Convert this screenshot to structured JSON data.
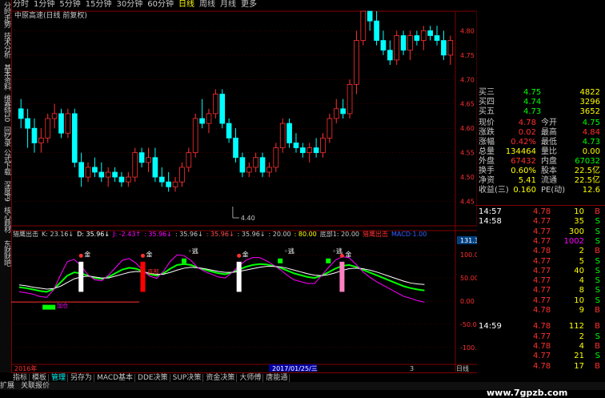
{
  "topbar": {
    "periods": [
      "分时",
      "1分钟",
      "5分钟",
      "15分钟",
      "30分钟",
      "60分钟",
      "日线",
      "周线",
      "月线",
      "更多"
    ],
    "active": "日线"
  },
  "left_tabs": [
    "分时走势",
    "技术分析",
    "基本资料",
    "维赛特10",
    "回忆录",
    "公式下载",
    "深度F9",
    "核心题材",
    "东财财吧"
  ],
  "title": "中原高速(日线 前复权)",
  "low_label": "4.40",
  "indicator_header": [
    {
      "text": "猎鹰出击",
      "color": "#c8c8c8"
    },
    {
      "text": "K: 23.16↓",
      "color": "#c8c8c8"
    },
    {
      "text": "D: 35.96↓",
      "color": "#ffffff"
    },
    {
      "text": "J: -2.43↑",
      "color": "#ff00ff"
    },
    {
      "text": ": 35.96↓",
      "color": "#ff00ff"
    },
    {
      "text": ": 35.96↓",
      "color": "#c8c8c8"
    },
    {
      "text": ": 35.96↓",
      "color": "#ff5050"
    },
    {
      "text": ": 35.96↓",
      "color": "#c8c8c8"
    },
    {
      "text": ": 20.00",
      "color": "#c8c8c8"
    },
    {
      "text": ": 80.00",
      "color": "#ffff00"
    },
    {
      "text": "底部1: 20.00",
      "color": "#c8c8c8"
    },
    {
      "text": "猎鹰出击",
      "color": "#ff3030"
    },
    {
      "text": "MACD·1.00",
      "color": "#3060ff"
    }
  ],
  "axis_labels": {
    "price": [
      "4.80",
      "4.75",
      "4.70",
      "4.65",
      "4.60",
      "4.55",
      "4.50",
      "4.45"
    ],
    "indicator": [
      "131.39",
      "100.00",
      "50.00",
      "0.00",
      "-50.00",
      "-100.00"
    ]
  },
  "signals": {
    "gold": "金",
    "escape": "逃",
    "bottom": "底部",
    "buy": "加仓"
  },
  "timeline": {
    "year": "2016年",
    "date": "2017/01/25/三",
    "mark": "3",
    "period": "日线"
  },
  "bottombar": {
    "tabs": [
      "指标",
      "模板",
      "管理",
      "另存为",
      "MACD基本",
      "DDE决策",
      "SUP决策",
      "资金决策",
      "大师傅",
      "唐能通"
    ],
    "active": "管理"
  },
  "statusbar": [
    "扩展",
    "关联报价"
  ],
  "watermark": "www.7gpzb.com",
  "orderbook": {
    "asks": [
      {
        "label": "买三",
        "price": "4.75",
        "vol": "4822"
      },
      {
        "label": "买四",
        "price": "4.74",
        "vol": "3296"
      },
      {
        "label": "买五",
        "price": "4.73",
        "vol": "3652"
      }
    ]
  },
  "quote": [
    {
      "l1": "现价",
      "v1": "4.78",
      "c1": "#ff3030",
      "l2": "今开",
      "v2": "4.75",
      "c2": "#00ff00"
    },
    {
      "l1": "涨跌",
      "v1": "0.02",
      "c1": "#ff3030",
      "l2": "最高",
      "v2": "4.84",
      "c2": "#ff3030"
    },
    {
      "l1": "涨幅",
      "v1": "0.42%",
      "c1": "#ff3030",
      "l2": "最低",
      "v2": "4.73",
      "c2": "#00ff00"
    },
    {
      "l1": "总量",
      "v1": "134464",
      "c1": "#ffff00",
      "l2": "量比",
      "v2": "0.00",
      "c2": "#ffff00"
    },
    {
      "l1": "外盘",
      "v1": "67432",
      "c1": "#ff3030",
      "l2": "内盘",
      "v2": "67032",
      "c2": "#00ff00"
    },
    {
      "l1": "换手",
      "v1": "0.60%",
      "c1": "#ffff00",
      "l2": "股本",
      "v2": "22.5亿",
      "c2": "#ffff00"
    },
    {
      "l1": "净资",
      "v1": "5.41",
      "c1": "#ffff00",
      "l2": "流通",
      "v2": "22.5亿",
      "c2": "#ffff00"
    },
    {
      "l1": "收益(三)",
      "v1": "0.160",
      "c1": "#ffff00",
      "l2": "PE(动)",
      "v2": "12.6",
      "c2": "#ffff00"
    }
  ],
  "trades": [
    {
      "time": "14:57",
      "price": "4.78",
      "vol": "10",
      "bs": "B",
      "vc": "#ffff00"
    },
    {
      "time": "14:58",
      "price": "4.77",
      "vol": "35",
      "bs": "S",
      "vc": "#ffff00"
    },
    {
      "time": "",
      "price": "4.77",
      "vol": "300",
      "bs": "S",
      "vc": "#ffff00"
    },
    {
      "time": "",
      "price": "4.77",
      "vol": "1002",
      "bs": "S",
      "vc": "#ff00ff"
    },
    {
      "time": "",
      "price": "4.78",
      "vol": "2",
      "bs": "B",
      "vc": "#ffff00"
    },
    {
      "time": "",
      "price": "4.77",
      "vol": "5",
      "bs": "S",
      "vc": "#ffff00"
    },
    {
      "time": "",
      "price": "4.77",
      "vol": "40",
      "bs": "S",
      "vc": "#ffff00"
    },
    {
      "time": "",
      "price": "4.77",
      "vol": "4",
      "bs": "S",
      "vc": "#ffff00"
    },
    {
      "time": "",
      "price": "4.77",
      "vol": "8",
      "bs": "S",
      "vc": "#ffff00"
    },
    {
      "time": "",
      "price": "4.77",
      "vol": "10",
      "bs": "S",
      "vc": "#ffff00"
    },
    {
      "time": "",
      "price": "4.78",
      "vol": "9",
      "bs": "B",
      "vc": "#ffff00"
    },
    {
      "time": "14:59",
      "price": "4.78",
      "vol": "112",
      "bs": "B",
      "vc": "#ffff00"
    },
    {
      "time": "",
      "price": "4.77",
      "vol": "2",
      "bs": "S",
      "vc": "#ffff00"
    },
    {
      "time": "",
      "price": "4.78",
      "vol": "4",
      "bs": "B",
      "vc": "#ffff00"
    },
    {
      "time": "",
      "price": "4.77",
      "vol": "21",
      "bs": "S",
      "vc": "#ffff00"
    },
    {
      "time": "",
      "price": "4.78",
      "vol": "17",
      "bs": "B",
      "vc": "#ffff00"
    }
  ],
  "colors": {
    "up": "#ff3030",
    "down": "#00ffff",
    "grid": "#800000",
    "bg": "#000000"
  },
  "chart_data": [
    {
      "type": "candlestick",
      "title": "中原高速(日线 前复权)",
      "ylim": [
        4.4,
        4.84
      ],
      "yticks": [
        4.45,
        4.5,
        4.55,
        4.6,
        4.65,
        4.7,
        4.75,
        4.8
      ],
      "candles": [
        [
          4.64,
          4.66,
          4.6,
          4.62
        ],
        [
          4.62,
          4.64,
          4.56,
          4.6
        ],
        [
          4.6,
          4.62,
          4.55,
          4.57
        ],
        [
          4.57,
          4.6,
          4.55,
          4.58
        ],
        [
          4.58,
          4.63,
          4.57,
          4.62
        ],
        [
          4.62,
          4.65,
          4.6,
          4.63
        ],
        [
          4.63,
          4.64,
          4.58,
          4.59
        ],
        [
          4.59,
          4.64,
          4.58,
          4.63
        ],
        [
          4.63,
          4.64,
          4.52,
          4.53
        ],
        [
          4.53,
          4.55,
          4.48,
          4.5
        ],
        [
          4.5,
          4.53,
          4.49,
          4.52
        ],
        [
          4.52,
          4.54,
          4.5,
          4.51
        ],
        [
          4.51,
          4.53,
          4.49,
          4.5
        ],
        [
          4.5,
          4.52,
          4.48,
          4.51
        ],
        [
          4.51,
          4.52,
          4.49,
          4.5
        ],
        [
          4.5,
          4.51,
          4.48,
          4.49
        ],
        [
          4.49,
          4.51,
          4.48,
          4.5
        ],
        [
          4.5,
          4.56,
          4.49,
          4.55
        ],
        [
          4.55,
          4.56,
          4.52,
          4.53
        ],
        [
          4.53,
          4.56,
          4.51,
          4.54
        ],
        [
          4.54,
          4.56,
          4.49,
          4.5
        ],
        [
          4.5,
          4.52,
          4.48,
          4.49
        ],
        [
          4.49,
          4.51,
          4.47,
          4.48
        ],
        [
          4.48,
          4.5,
          4.47,
          4.49
        ],
        [
          4.49,
          4.53,
          4.48,
          4.52
        ],
        [
          4.52,
          4.56,
          4.51,
          4.55
        ],
        [
          4.55,
          4.63,
          4.54,
          4.62
        ],
        [
          4.62,
          4.66,
          4.6,
          4.61
        ],
        [
          4.61,
          4.64,
          4.59,
          4.63
        ],
        [
          4.63,
          4.68,
          4.62,
          4.67
        ],
        [
          4.67,
          4.68,
          4.6,
          4.61
        ],
        [
          4.61,
          4.62,
          4.57,
          4.58
        ],
        [
          4.58,
          4.6,
          4.53,
          4.54
        ],
        [
          4.54,
          4.55,
          4.5,
          4.51
        ],
        [
          4.51,
          4.53,
          4.5,
          4.52
        ],
        [
          4.52,
          4.55,
          4.51,
          4.54
        ],
        [
          4.54,
          4.55,
          4.5,
          4.51
        ],
        [
          4.51,
          4.53,
          4.5,
          4.52
        ],
        [
          4.52,
          4.57,
          4.51,
          4.56
        ],
        [
          4.56,
          4.62,
          4.55,
          4.61
        ],
        [
          4.61,
          4.62,
          4.56,
          4.57
        ],
        [
          4.57,
          4.59,
          4.55,
          4.56
        ],
        [
          4.56,
          4.57,
          4.54,
          4.55
        ],
        [
          4.55,
          4.57,
          4.53,
          4.56
        ],
        [
          4.56,
          4.58,
          4.54,
          4.55
        ],
        [
          4.55,
          4.59,
          4.54,
          4.58
        ],
        [
          4.58,
          4.63,
          4.57,
          4.62
        ],
        [
          4.62,
          4.66,
          4.61,
          4.64
        ],
        [
          4.64,
          4.66,
          4.62,
          4.63
        ],
        [
          4.63,
          4.7,
          4.62,
          4.69
        ],
        [
          4.69,
          4.8,
          4.67,
          4.78
        ],
        [
          4.78,
          4.9,
          4.77,
          4.86
        ],
        [
          4.86,
          4.88,
          4.8,
          4.82
        ],
        [
          4.82,
          4.84,
          4.77,
          4.78
        ],
        [
          4.78,
          4.8,
          4.75,
          4.76
        ],
        [
          4.76,
          4.78,
          4.73,
          4.74
        ],
        [
          4.74,
          4.8,
          4.73,
          4.79
        ],
        [
          4.79,
          4.8,
          4.75,
          4.76
        ],
        [
          4.76,
          4.8,
          4.74,
          4.79
        ],
        [
          4.79,
          4.8,
          4.77,
          4.78
        ],
        [
          4.78,
          4.81,
          4.76,
          4.8
        ],
        [
          4.8,
          4.81,
          4.78,
          4.79
        ],
        [
          4.79,
          4.81,
          4.77,
          4.78
        ],
        [
          4.78,
          4.8,
          4.74,
          4.75
        ],
        [
          4.75,
          4.79,
          4.73,
          4.78
        ]
      ],
      "low_marker": {
        "index": 33,
        "price": 4.4
      }
    },
    {
      "type": "line",
      "title": "猎鹰出击",
      "ylim": [
        -131.39,
        131.39
      ],
      "yticks": [
        131.39,
        100,
        50,
        0,
        -50,
        -100
      ],
      "series": [
        {
          "name": "K",
          "color": "#00ff00",
          "values": [
            30,
            28,
            25,
            22,
            20,
            26,
            40,
            55,
            62,
            60,
            55,
            50,
            48,
            52,
            60,
            68,
            72,
            70,
            64,
            58,
            55,
            60,
            70,
            78,
            80,
            78,
            72,
            68,
            64,
            60,
            58,
            62,
            68,
            74,
            78,
            80,
            79,
            76,
            72,
            66,
            60,
            56,
            52,
            50,
            55,
            62,
            70,
            76,
            78,
            74,
            68,
            62,
            56,
            50,
            44,
            38,
            32,
            28,
            25,
            23
          ]
        },
        {
          "name": "D",
          "color": "#ffffff",
          "values": [
            35,
            33,
            30,
            28,
            26,
            27,
            32,
            40,
            48,
            52,
            54,
            52,
            50,
            50,
            54,
            58,
            62,
            64,
            63,
            60,
            58,
            58,
            62,
            67,
            71,
            73,
            72,
            70,
            67,
            64,
            62,
            62,
            64,
            67,
            70,
            73,
            75,
            75,
            74,
            71,
            67,
            63,
            59,
            56,
            55,
            57,
            61,
            66,
            70,
            71,
            70,
            67,
            63,
            58,
            53,
            48,
            43,
            39,
            37,
            35.96
          ]
        },
        {
          "name": "J",
          "color": "#ff00ff",
          "values": [
            20,
            18,
            15,
            10,
            8,
            24,
            56,
            85,
            90,
            76,
            57,
            46,
            44,
            56,
            72,
            88,
            92,
            82,
            66,
            54,
            49,
            64,
            86,
            100,
            98,
            88,
            72,
            64,
            58,
            52,
            50,
            62,
            76,
            88,
            94,
            94,
            87,
            78,
            68,
            56,
            46,
            42,
            38,
            38,
            55,
            72,
            88,
            96,
            94,
            80,
            64,
            52,
            42,
            34,
            26,
            18,
            10,
            6,
            1,
            -2.43
          ]
        }
      ],
      "signals": [
        {
          "index": 9,
          "type": "gold",
          "color": "#ffffff"
        },
        {
          "index": 18,
          "type": "gold",
          "color": "#ff0000"
        },
        {
          "index": 24,
          "type": "escape"
        },
        {
          "index": 32,
          "type": "gold",
          "color": "#ffffff"
        },
        {
          "index": 38,
          "type": "escape"
        },
        {
          "index": 45,
          "type": "escape"
        },
        {
          "index": 47,
          "type": "gold",
          "color": "#ff80c0"
        },
        {
          "index": 2,
          "type": "buy"
        }
      ]
    }
  ]
}
